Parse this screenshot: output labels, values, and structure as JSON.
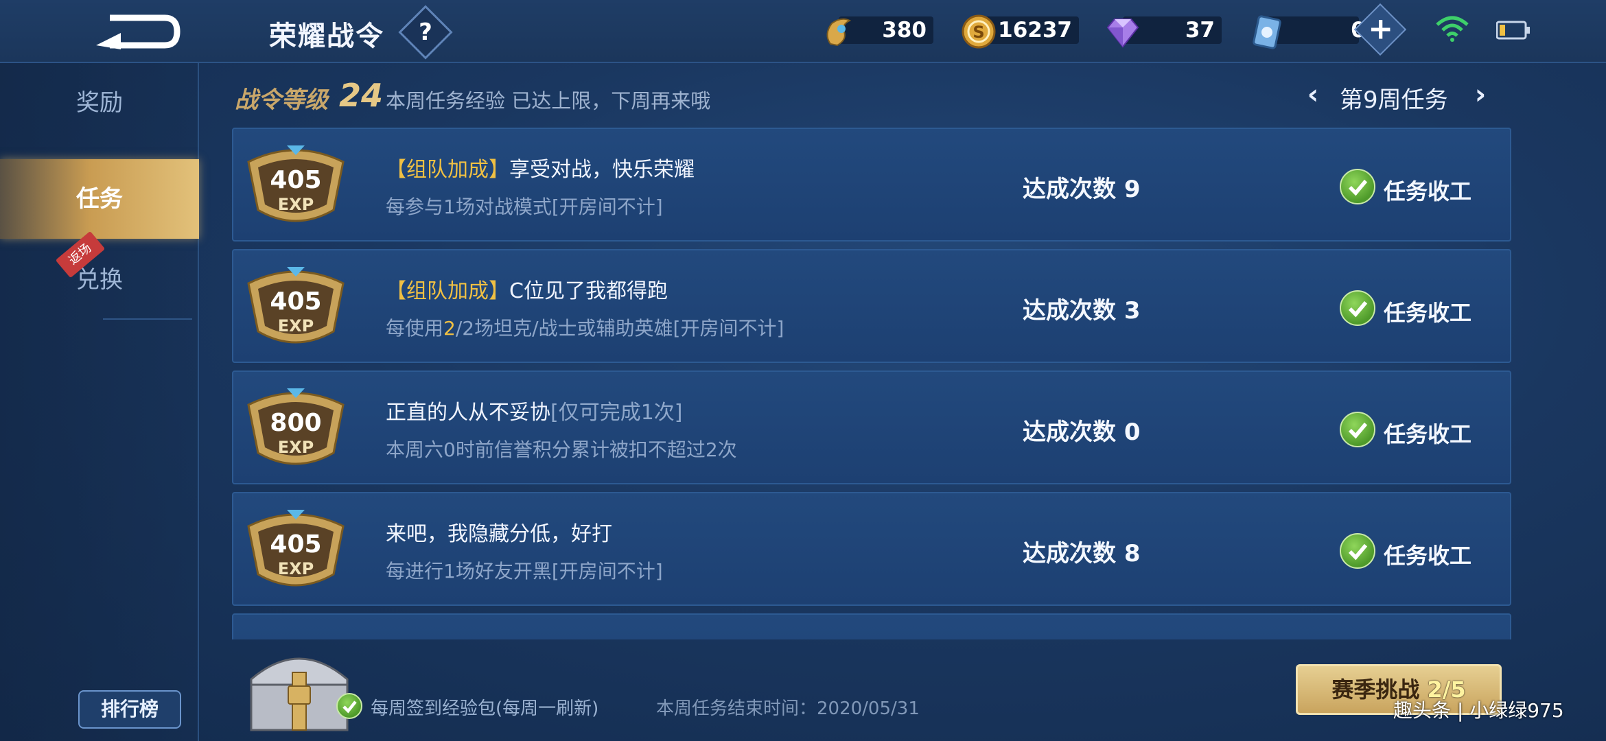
{
  "header": {
    "title": "荣耀战令",
    "help_label": "?"
  },
  "currencies": [
    {
      "name": "token",
      "value": "380"
    },
    {
      "name": "gold",
      "value": "16237"
    },
    {
      "name": "diamond",
      "value": "37"
    },
    {
      "name": "card",
      "value": "0"
    }
  ],
  "plus_label": "+",
  "sidebar": {
    "items": [
      {
        "label": "奖励"
      },
      {
        "label": "任务"
      },
      {
        "label": "兑换"
      }
    ],
    "return_tag": "返场",
    "rank_button": "排行榜"
  },
  "pass_level": {
    "label": "战令等级",
    "value": "24",
    "note": "本周任务经验 已达上限，下周再来哦"
  },
  "week": {
    "label": "第9周任务",
    "prev_icon": "‹",
    "next_icon": "›"
  },
  "tasks": [
    {
      "exp": "405",
      "exp_label": "EXP",
      "tag": "【组队加成】",
      "title": "享受对战，快乐荣耀",
      "limit": "",
      "desc_pre": "每参与1场对战模式[开房间不计]",
      "desc_hl": "",
      "desc_post": "",
      "count": "达成次数 9",
      "status": "任务收工"
    },
    {
      "exp": "405",
      "exp_label": "EXP",
      "tag": "【组队加成】",
      "title": "C位见了我都得跑",
      "limit": "",
      "desc_pre": "每使用",
      "desc_hl": "2",
      "desc_post": "/2场坦克/战士或辅助英雄[开房间不计]",
      "count": "达成次数 3",
      "status": "任务收工"
    },
    {
      "exp": "800",
      "exp_label": "EXP",
      "tag": "",
      "title": "正直的人从不妥协",
      "limit": "[仅可完成1次]",
      "desc_pre": "本周六0时前信誉积分累计被扣不超过2次",
      "desc_hl": "",
      "desc_post": "",
      "count": "达成次数 0",
      "status": "任务收工"
    },
    {
      "exp": "405",
      "exp_label": "EXP",
      "tag": "",
      "title": "来吧，我隐藏分低，好打",
      "limit": "",
      "desc_pre": "每进行1场好友开黑[开房间不计]",
      "desc_hl": "",
      "desc_post": "",
      "count": "达成次数 8",
      "status": "任务收工"
    }
  ],
  "footer": {
    "weekly_label": "每周签到经验包(每周一刷新)",
    "end_time": "本周任务结束时间：2020/05/31",
    "season_label": "赛季挑战 ",
    "season_progress": "2/5"
  },
  "watermark": "趣头条 | 小绿绿975",
  "colors": {
    "accent_gold": "#f0c043",
    "check_green": "#4e9a2a",
    "background": "#1a3760"
  }
}
